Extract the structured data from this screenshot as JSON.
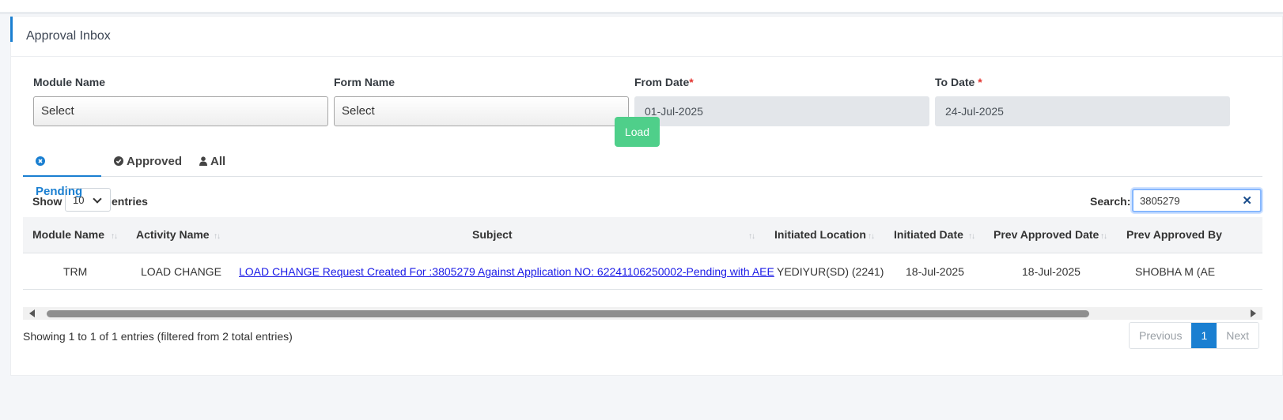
{
  "page": {
    "title": "Approval Inbox"
  },
  "filters": {
    "module_label": "Module Name",
    "module_value": "Select",
    "form_label": "Form Name",
    "form_value": "Select",
    "from_label": "From Date",
    "from_value": "01-Jul-2025",
    "to_label": "To Date ",
    "to_value": "24-Jul-2025",
    "required_mark": "*",
    "load_label": "Load"
  },
  "tabs": [
    {
      "label": "Pending",
      "icon": "times-circle-icon",
      "active": true
    },
    {
      "label": "Approved",
      "icon": "check-circle-icon",
      "active": false
    },
    {
      "label": "All",
      "icon": "user-icon",
      "active": false
    }
  ],
  "table_controls": {
    "show_label": "Show",
    "entries_label": "entries",
    "page_length": "10",
    "search_label": "Search:",
    "search_value": "3805279"
  },
  "table": {
    "columns": [
      "Module Name",
      "Activity Name",
      "Subject",
      "Initiated Location",
      "Initiated Date",
      "Prev Approved Date",
      "Prev Approved By"
    ],
    "rows": [
      {
        "module": "TRM",
        "activity": "LOAD CHANGE",
        "subject": "LOAD CHANGE Request Created For :3805279 Against Application NO: 62241106250002-Pending with AEE",
        "location": "YEDIYUR(SD) (2241)",
        "initiated_date": "18-Jul-2025",
        "prev_approved_date": "18-Jul-2025",
        "prev_approved_by": "SHOBHA M (AE"
      }
    ]
  },
  "footer": {
    "info": "Showing 1 to 1 of 1 entries (filtered from 2 total entries)",
    "previous": "Previous",
    "current_page": "1",
    "next": "Next"
  },
  "colors": {
    "accent": "#1a7fd1",
    "load_button": "#4fcf8a",
    "link": "#1a1ae6"
  }
}
